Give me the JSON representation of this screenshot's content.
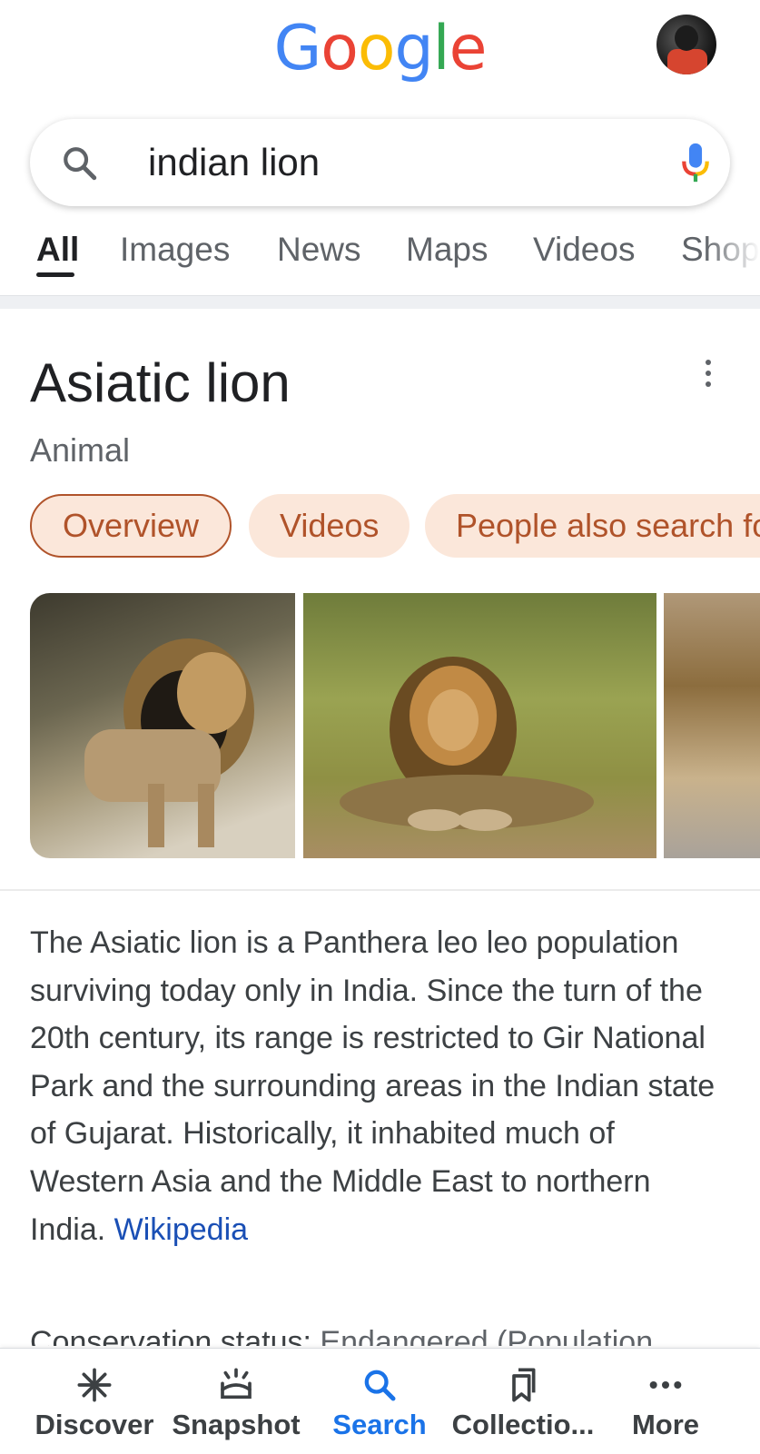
{
  "header": {
    "logo": {
      "letters": [
        "G",
        "o",
        "o",
        "g",
        "l",
        "e"
      ],
      "colors": [
        "#4285F4",
        "#EA4335",
        "#FBBC05",
        "#4285F4",
        "#34A853",
        "#EA4335"
      ]
    }
  },
  "search": {
    "query": "indian lion"
  },
  "tabs": [
    "All",
    "Images",
    "News",
    "Maps",
    "Videos",
    "Shop"
  ],
  "active_tab": "All",
  "knowledge_panel": {
    "title": "Asiatic lion",
    "subtitle": "Animal",
    "chips": [
      "Overview",
      "Videos",
      "People also search fo"
    ],
    "active_chip": "Overview",
    "description": "The Asiatic lion is a Panthera leo leo population surviving today only in India. Since the turn of the 20th century, its range is restricted to Gir National Park and the surrounding areas in the Indian state of Gujarat. Historically, it inhabited much of Western Asia and the Middle East to northern India.",
    "source_link": "Wikipedia",
    "conservation_label": "Conservation status:",
    "conservation_value": "Endangered (Population"
  },
  "bottom_nav": [
    {
      "label": "Discover",
      "icon": "asterisk-icon"
    },
    {
      "label": "Snapshot",
      "icon": "snapshot-icon"
    },
    {
      "label": "Search",
      "icon": "search-icon"
    },
    {
      "label": "Collectio...",
      "icon": "bookmark-icon"
    },
    {
      "label": "More",
      "icon": "more-dots-icon"
    }
  ],
  "active_nav": "Search",
  "colors": {
    "accent_blue": "#1A73E8",
    "link_blue": "#1A4FB5",
    "chip_bg": "#FBE7DA",
    "chip_text": "#B0532A"
  }
}
